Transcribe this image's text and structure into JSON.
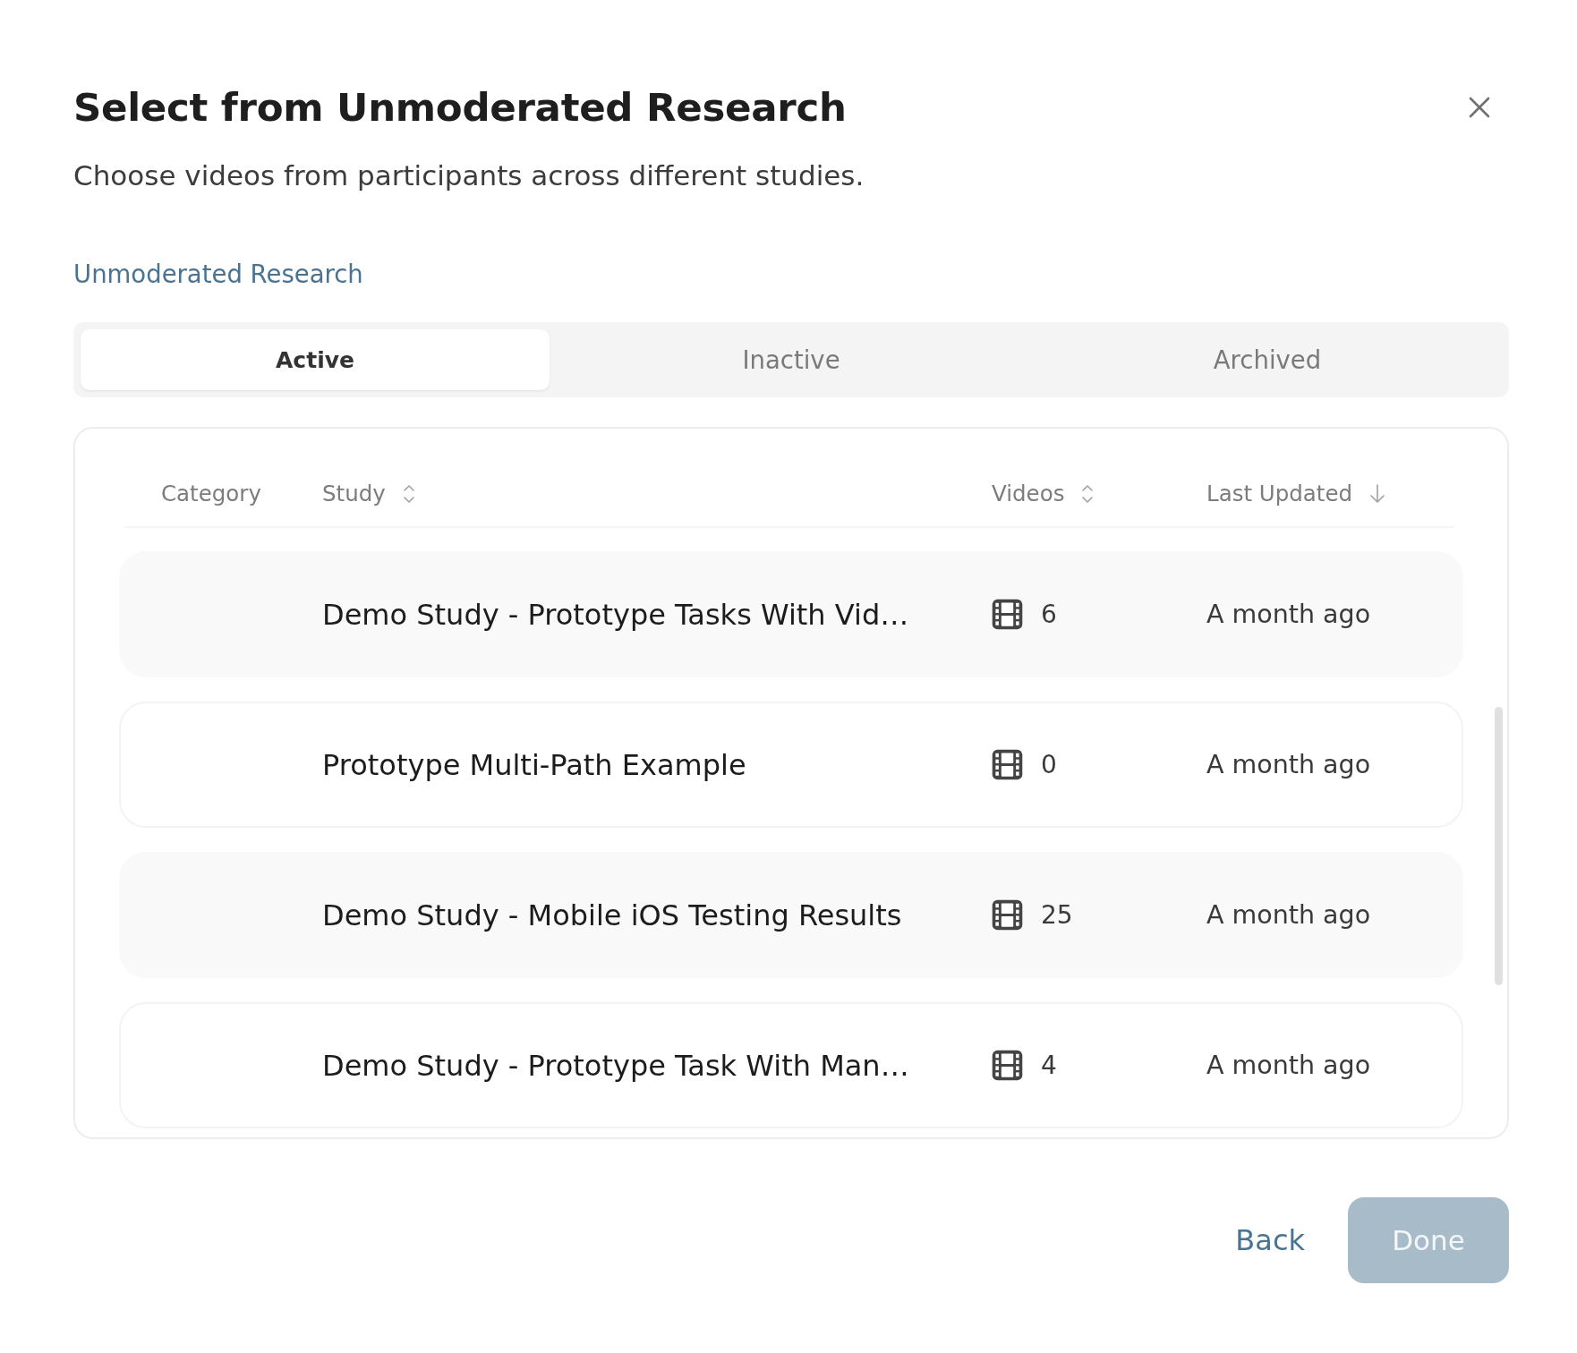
{
  "dialog": {
    "title": "Select from Unmoderated Research",
    "subtitle": "Choose videos from participants across different studies."
  },
  "breadcrumb": "Unmoderated Research",
  "tabs": [
    {
      "label": "Active",
      "selected": true
    },
    {
      "label": "Inactive",
      "selected": false
    },
    {
      "label": "Archived",
      "selected": false
    }
  ],
  "table": {
    "columns": [
      {
        "label": "Category",
        "kind": "plain"
      },
      {
        "label": "Study",
        "kind": "sortable"
      },
      {
        "label": "Videos",
        "kind": "sortable"
      },
      {
        "label": "Last Updated",
        "kind": "descending"
      }
    ],
    "rows": [
      {
        "study": "Demo Study - Prototype Tasks With Vid…",
        "videos": "6",
        "last_updated": "A month ago"
      },
      {
        "study": "Prototype Multi-Path Example",
        "videos": "0",
        "last_updated": "A month ago"
      },
      {
        "study": "Demo Study - Mobile iOS Testing Results",
        "videos": "25",
        "last_updated": "A month ago"
      },
      {
        "study": "Demo Study - Prototype Task With Man…",
        "videos": "4",
        "last_updated": "A month ago"
      }
    ]
  },
  "footer": {
    "buttons": [
      {
        "kind": "link",
        "label": "Back",
        "disabled": false
      },
      {
        "kind": "primary",
        "label": "Done",
        "disabled": true
      }
    ]
  }
}
